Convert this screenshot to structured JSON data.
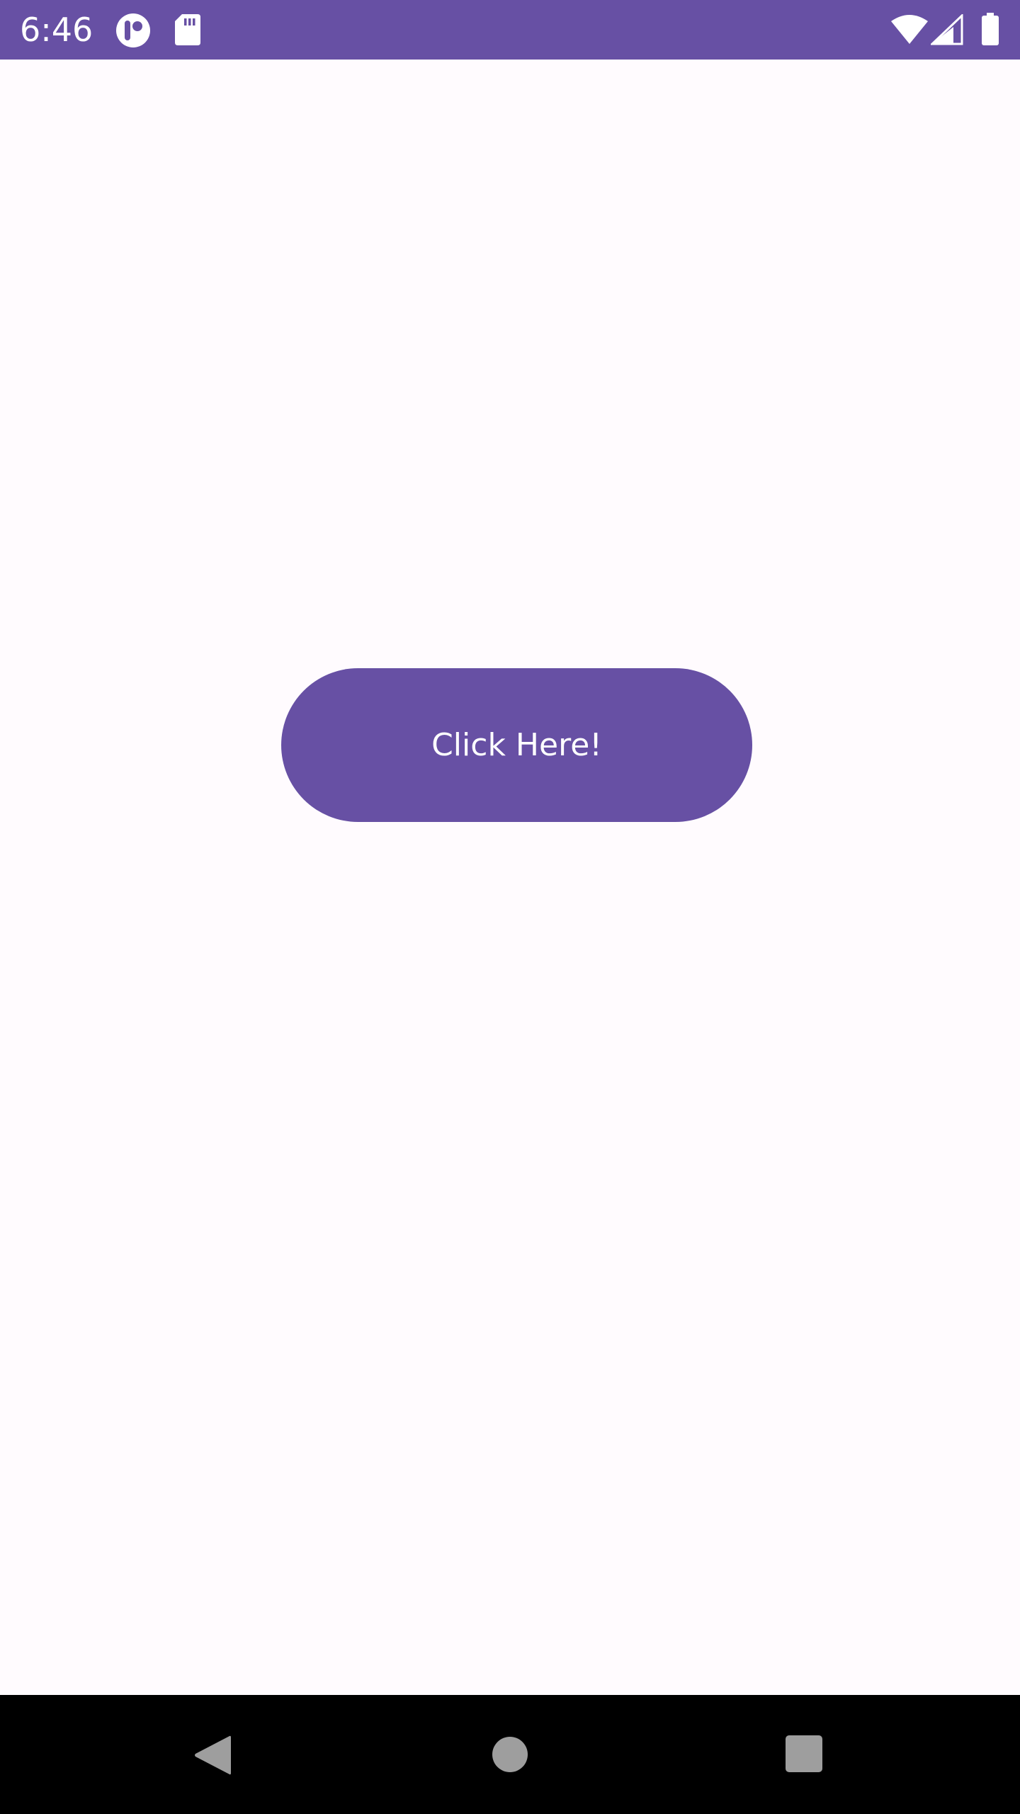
{
  "status_bar": {
    "time": "6:46",
    "background": "#6750a4",
    "notification_icons": [
      "app-notification-icon",
      "sd-card-icon"
    ],
    "system_icons": [
      "wifi-icon",
      "cellular-signal-icon",
      "battery-icon"
    ]
  },
  "main": {
    "background": "#fffbfe",
    "button": {
      "label": "Click Here!",
      "color": "#6750a4",
      "text_color": "#ffffff"
    }
  },
  "nav_bar": {
    "background": "#000000",
    "buttons": [
      "back-icon",
      "home-icon",
      "recents-icon"
    ]
  }
}
